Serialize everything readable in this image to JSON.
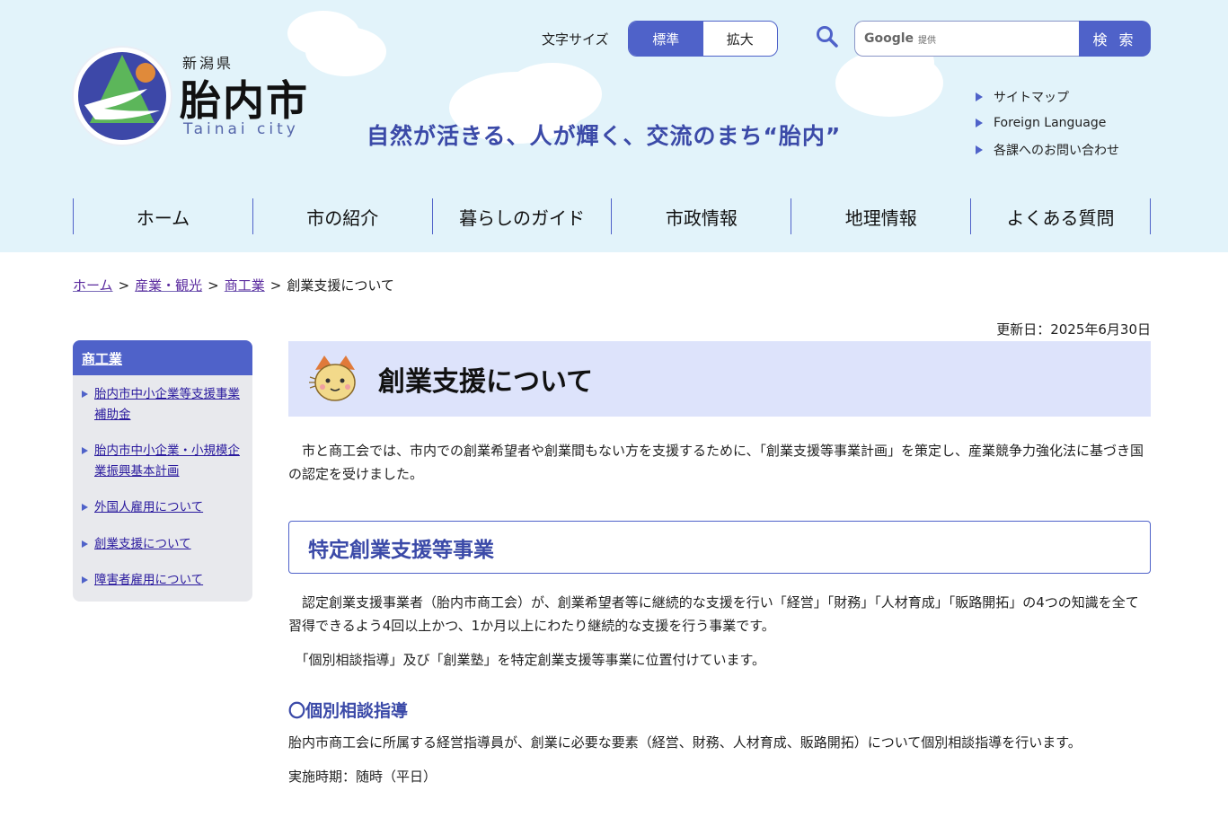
{
  "header": {
    "prefecture": "新潟県",
    "city_name": "胎内市",
    "city_en": "Tainai city",
    "slogan": "自然が活きる、人が輝く、交流のまち“胎内”",
    "font_size": {
      "label": "文字サイズ",
      "standard": "標準",
      "large": "拡大",
      "selected": "標準"
    },
    "search": {
      "brand": "Google",
      "brand_sub": "提供",
      "button": "検 索",
      "value": ""
    },
    "util_links": [
      "サイトマップ",
      "Foreign Language",
      "各課へのお問い合わせ"
    ]
  },
  "global_nav": [
    "ホーム",
    "市の紹介",
    "暮らしのガイド",
    "市政情報",
    "地理情報",
    "よくある質問"
  ],
  "breadcrumb": {
    "items": [
      "ホーム",
      "産業・観光",
      "商工業"
    ],
    "current": "創業支援について",
    "separator": ">"
  },
  "updated": "更新日：2025年6月30日",
  "sidebar": {
    "heading": "商工業",
    "items": [
      "胎内市中小企業等支援事業補助金",
      "胎内市中小企業・小規模企業振興基本計画",
      "外国人雇用について",
      "創業支援について",
      "障害者雇用について"
    ]
  },
  "main": {
    "title": "創業支援について",
    "intro": "　市と商工会では、市内での創業希望者や創業間もない方を支援するために、「創業支援等事業計画」を策定し、産業競争力強化法に基づき国の認定を受けました。",
    "section1": {
      "heading": "特定創業支援等事業",
      "p1": "　認定創業支援事業者（胎内市商工会）が、創業希望者等に継続的な支援を行い「経営」「財務」「人材育成」「販路開拓」の4つの知識を全て習得できるよう4回以上かつ、1か月以上にわたり継続的な支援を行う事業です。",
      "p2": "　「個別相談指導」及び「創業塾」を特定創業支援等事業に位置付けています。"
    },
    "section2": {
      "heading": "〇個別相談指導",
      "p1": "胎内市商工会に所属する経営指導員が、創業に必要な要素（経営、財務、人材育成、販路開拓）について個別相談指導を行います。",
      "p2": "実施時期：随時（平日）"
    }
  },
  "colors": {
    "accent": "#4f62c9",
    "header_bg": "#e2f3fa",
    "title_bg": "#dde3fb",
    "heading_text": "#3b4aa8"
  }
}
